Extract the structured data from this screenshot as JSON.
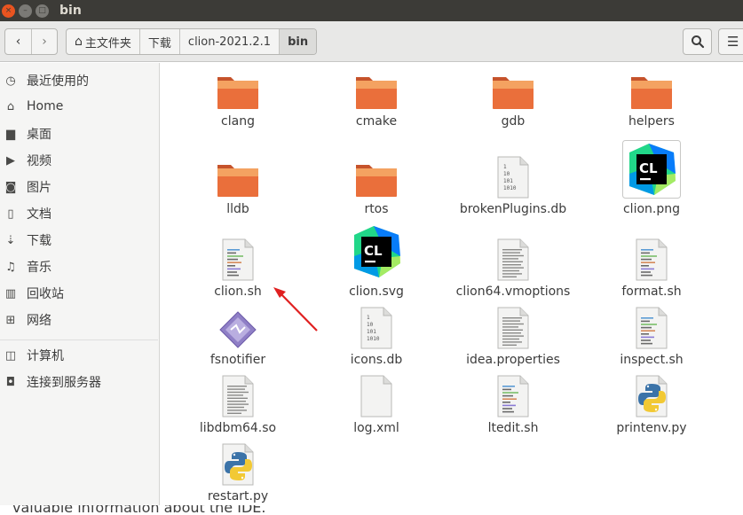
{
  "window": {
    "title": "bin",
    "close_glyph": "×",
    "minimize_glyph": "–",
    "maximize_glyph": "□"
  },
  "toolbar": {
    "back_glyph": "‹",
    "forward_glyph": "›",
    "menu_glyph": "☰",
    "breadcrumbs": [
      "主文件夹",
      "下载",
      "clion-2021.2.1",
      "bin"
    ]
  },
  "sidebar": {
    "items": [
      {
        "label": "最近使用的",
        "icon": "clock-icon",
        "glyph": "◷"
      },
      {
        "label": "Home",
        "icon": "home-icon",
        "glyph": "⌂"
      },
      {
        "label": "桌面",
        "icon": "desktop-folder-icon",
        "glyph": "▆"
      },
      {
        "label": "视频",
        "icon": "video-icon",
        "glyph": "▶"
      },
      {
        "label": "图片",
        "icon": "camera-icon",
        "glyph": "◙"
      },
      {
        "label": "文档",
        "icon": "document-icon",
        "glyph": "▯"
      },
      {
        "label": "下载",
        "icon": "download-icon",
        "glyph": "⇣"
      },
      {
        "label": "音乐",
        "icon": "music-icon",
        "glyph": "♫"
      },
      {
        "label": "回收站",
        "icon": "trash-icon",
        "glyph": "▥"
      },
      {
        "label": "网络",
        "icon": "network-icon",
        "glyph": "⊞"
      },
      {
        "label": "计算机",
        "icon": "computer-drive-icon",
        "glyph": "◫"
      },
      {
        "label": "连接到服务器",
        "icon": "server-connect-icon",
        "glyph": "◘"
      }
    ]
  },
  "files": [
    {
      "name": "clang",
      "type": "folder"
    },
    {
      "name": "cmake",
      "type": "folder"
    },
    {
      "name": "gdb",
      "type": "folder"
    },
    {
      "name": "helpers",
      "type": "folder"
    },
    {
      "name": "lldb",
      "type": "folder"
    },
    {
      "name": "rtos",
      "type": "folder"
    },
    {
      "name": "brokenPlugins.db",
      "type": "binary"
    },
    {
      "name": "clion.png",
      "type": "clion-logo-png"
    },
    {
      "name": "clion.sh",
      "type": "script"
    },
    {
      "name": "clion.svg",
      "type": "clion-logo"
    },
    {
      "name": "clion64.vmoptions",
      "type": "text"
    },
    {
      "name": "format.sh",
      "type": "script"
    },
    {
      "name": "fsnotifier",
      "type": "executable"
    },
    {
      "name": "icons.db",
      "type": "binary"
    },
    {
      "name": "idea.properties",
      "type": "text"
    },
    {
      "name": "inspect.sh",
      "type": "script"
    },
    {
      "name": "libdbm64.so",
      "type": "text"
    },
    {
      "name": "log.xml",
      "type": "xml"
    },
    {
      "name": "ltedit.sh",
      "type": "script"
    },
    {
      "name": "printenv.py",
      "type": "python"
    },
    {
      "name": "restart.py",
      "type": "python"
    }
  ],
  "binary_glyph_lines": [
    "1",
    "10",
    "101",
    "1010"
  ],
  "clion_logo_text": "CL",
  "xml_glyph": "</>",
  "background_text": "valuable information about the IDE.",
  "colors": {
    "accent": "#e95420",
    "folder_top": "#f4a261",
    "folder_body": "#e8693a",
    "annotation_arrow": "#e02020"
  }
}
